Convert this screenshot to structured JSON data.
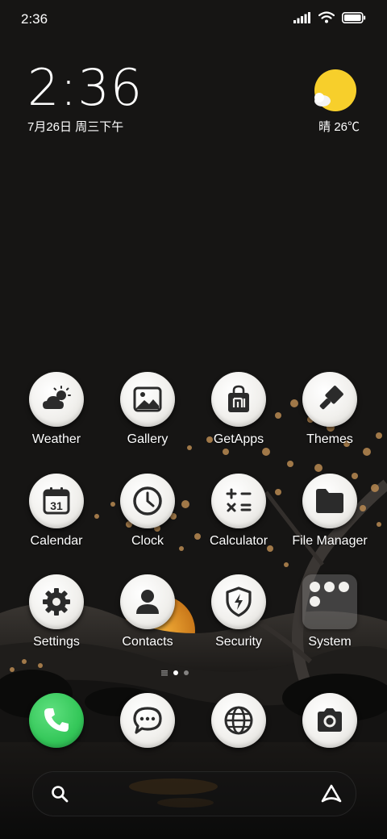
{
  "status_bar": {
    "time": "2:36"
  },
  "clock_widget": {
    "time": "2:36",
    "date": "7月26日 周三下午"
  },
  "weather_widget": {
    "condition": "晴",
    "temperature": "26℃",
    "sun_color": "#f7cf2b"
  },
  "apps": {
    "row1": [
      "Weather",
      "Gallery",
      "GetApps",
      "Themes"
    ],
    "row2": [
      "Calendar",
      "Clock",
      "Calculator",
      "File Manager"
    ],
    "row3": [
      "Settings",
      "Contacts",
      "Security",
      "System"
    ]
  },
  "calendar_day": "31",
  "dock": [
    "phone",
    "messages",
    "browser",
    "camera"
  ],
  "page_indicator": {
    "pages": 2,
    "active": 1
  },
  "colors": {
    "phone_green": "#34c759",
    "icon_dark": "#2b2b2b"
  }
}
